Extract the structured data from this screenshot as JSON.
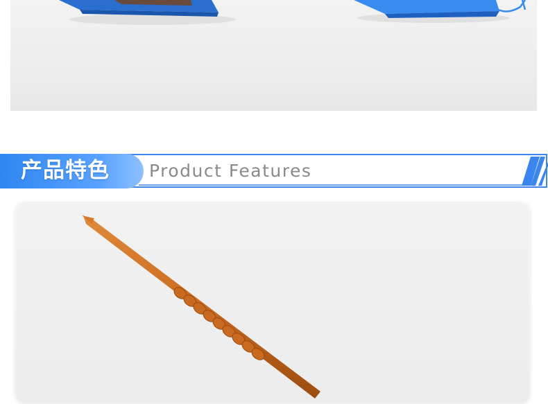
{
  "banner": {
    "title_cn": "产品特色",
    "title_en": "Product Features"
  },
  "colors": {
    "accent_blue": "#2f7fe6",
    "rod_orange": "#c96a1e",
    "card_bg": "#ededed"
  },
  "images": {
    "top": "product-photo-blue-trays",
    "main": "product-photo-orange-rod"
  }
}
